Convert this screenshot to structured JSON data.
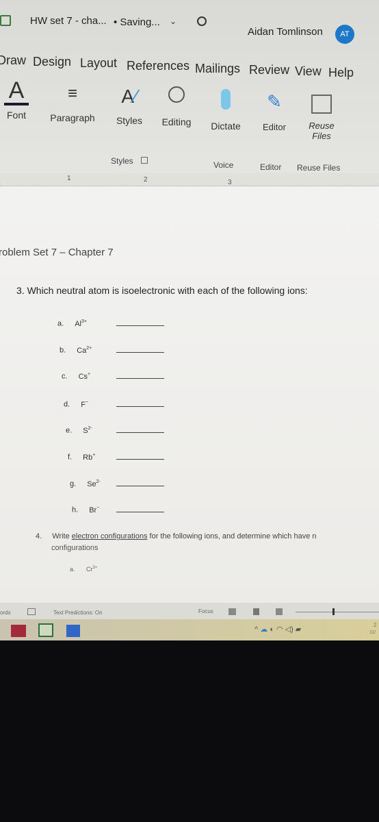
{
  "titlebar": {
    "doc_title": "HW set 7 - cha...",
    "status": "• Saving...",
    "user_name": "Aidan Tomlinson",
    "avatar_initials": "AT",
    "accent": "#1e78c8"
  },
  "tabs": [
    "Draw",
    "Design",
    "Layout",
    "References",
    "Mailings",
    "Review",
    "View",
    "Help"
  ],
  "ribbon": {
    "groups": [
      {
        "label": "Font"
      },
      {
        "label": "Paragraph"
      },
      {
        "label": "Styles"
      },
      {
        "label": "Editing"
      },
      {
        "label": "Dictate"
      },
      {
        "label": "Editor"
      },
      {
        "label": "Reuse Files"
      }
    ],
    "group_labels": [
      "Styles",
      "Voice",
      "Editor",
      "Reuse Files"
    ]
  },
  "ruler": {
    "marks": [
      "1",
      "2",
      "3"
    ]
  },
  "document": {
    "heading": "roblem Set 7 – Chapter 7",
    "q3": "3.  Which neutral atom is isoelectronic with each of the following ions:",
    "q3_items": [
      {
        "letter": "a.",
        "ion": "Al",
        "charge": "3+"
      },
      {
        "letter": "b.",
        "ion": "Ca",
        "charge": "2+"
      },
      {
        "letter": "c.",
        "ion": "Cs",
        "charge": "+"
      },
      {
        "letter": "d.",
        "ion": "F",
        "charge": "−"
      },
      {
        "letter": "e.",
        "ion": "S",
        "charge": "2-"
      },
      {
        "letter": "f.",
        "ion": "Rb",
        "charge": "+"
      },
      {
        "letter": "g.",
        "ion": "Se",
        "charge": "2-"
      },
      {
        "letter": "h.",
        "ion": "Br",
        "charge": "−"
      }
    ],
    "q4_num": "4.",
    "q4_pre": "Write ",
    "q4_link": "electron configurations",
    "q4_post": " for the following ions, and determine which have n",
    "q4_line2": "configurations",
    "q4_item": {
      "letter": "a.",
      "ion": "Cr",
      "charge": "3+"
    }
  },
  "statusbar": {
    "words": "ords",
    "text_predictions": "Text Predictions: On",
    "focus": "Focus"
  },
  "taskbar": {
    "time": "2",
    "date": "11/"
  }
}
